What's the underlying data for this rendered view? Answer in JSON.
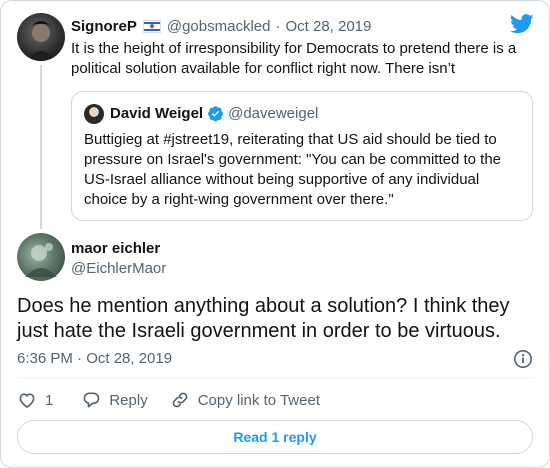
{
  "colors": {
    "brand": "#1d9bf0",
    "text": "#0f1419",
    "muted": "#536471",
    "border": "#cfd9de"
  },
  "icons": {
    "logo": "twitter-bird",
    "flag": "israel-flag",
    "verified": "verified-badge",
    "info": "info-circle",
    "like": "heart-outline",
    "reply": "speech-bubble",
    "copy": "link"
  },
  "parent": {
    "display_name": "SignoreP",
    "handle": "@gobsmackled",
    "dot": "·",
    "date": "Oct 28, 2019",
    "text": "It is the height of irresponsibility for Democrats to pretend there is a political solution available for conflict right now. There isn’t"
  },
  "quote": {
    "display_name": "David Weigel",
    "handle": "@daveweigel",
    "text": "Buttigieg at #jstreet19, reiterating that US aid should be tied to pressure on Israel's government: \"You can be committed to the US-Israel alliance without being supportive of any individual choice by a right-wing government over there.\""
  },
  "tweet": {
    "display_name": "maor eichler",
    "handle": "@EichlerMaor",
    "text": "Does he mention anything about a solution? I think they just hate the Israeli government in order to be virtuous.",
    "timestamp": "6:36 PM · Oct 28, 2019"
  },
  "actions": {
    "like_count": "1",
    "reply_label": "Reply",
    "copy_label": "Copy link to Tweet"
  },
  "read_replies_label": "Read 1 reply"
}
